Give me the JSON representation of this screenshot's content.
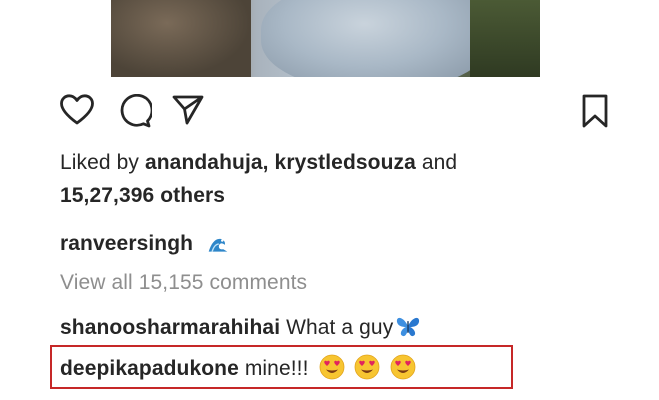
{
  "post": {
    "liked_by_prefix": "Liked by",
    "liked_users": [
      "anandahuja",
      "krystledsouza"
    ],
    "liked_joiner": "and",
    "others_count": "15,27,396 others",
    "author": "ranveersingh",
    "caption_emoji": "water-wave-emoji",
    "view_comments": "View all 15,155 comments"
  },
  "comments": [
    {
      "user": "shanoosharmarahihai",
      "text": "What a guy",
      "emoji": "blue-butterfly-emoji"
    },
    {
      "user": "deepikapadukone",
      "text": "mine!!!",
      "emoji": "heart-eyes-emoji x3",
      "highlighted": true
    }
  ],
  "colors": {
    "text": "#262626",
    "muted": "#8e8e8e",
    "highlight": "#c62828"
  },
  "icons": [
    "heart-icon",
    "comment-icon",
    "share-icon",
    "bookmark-icon"
  ]
}
